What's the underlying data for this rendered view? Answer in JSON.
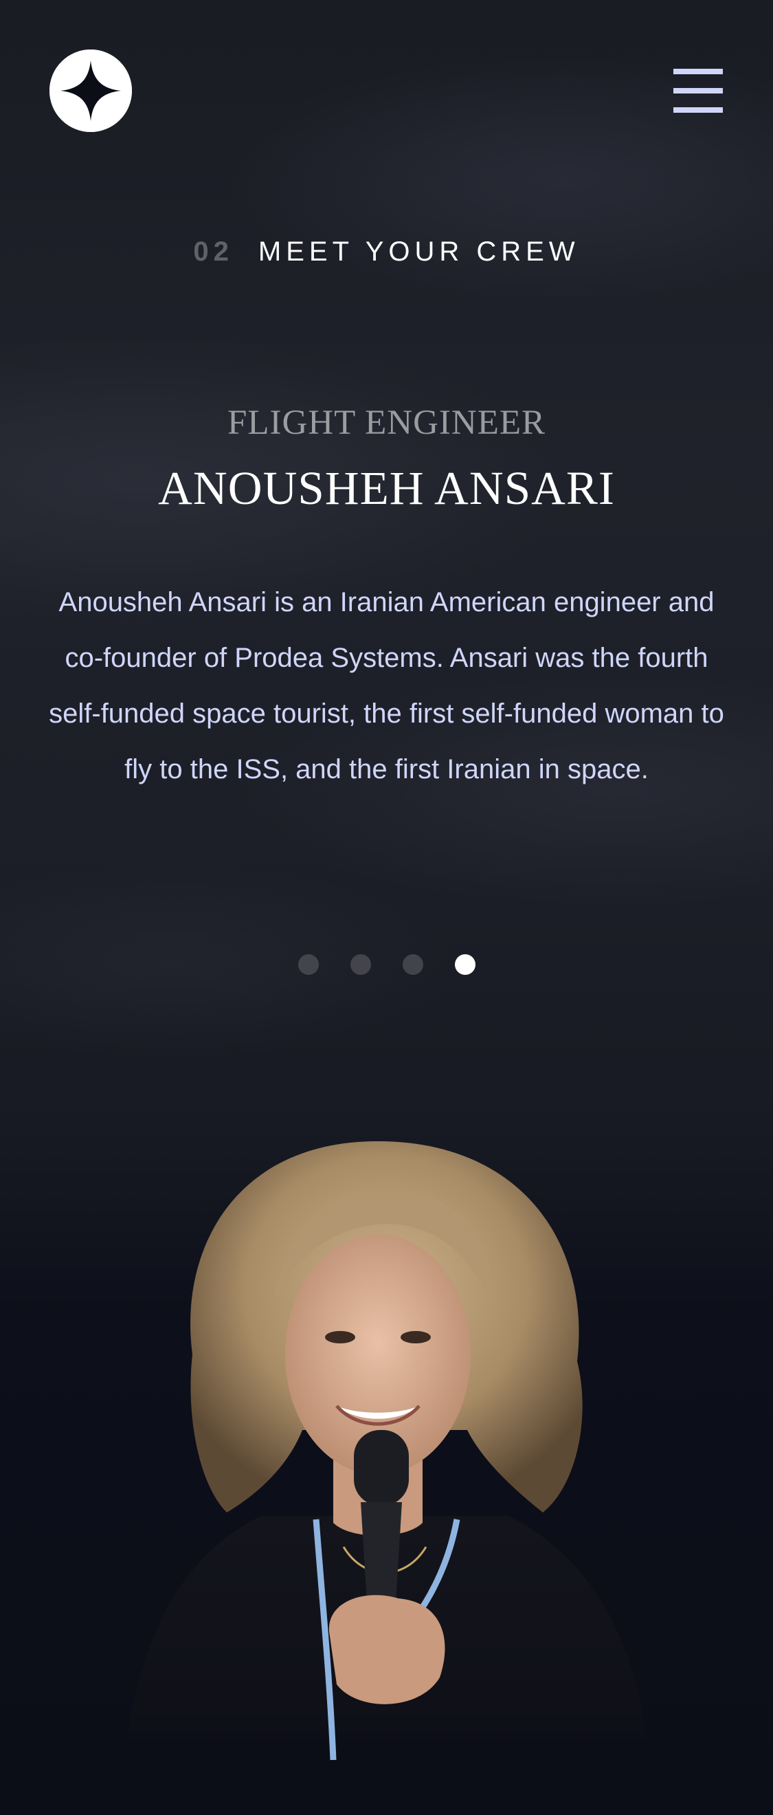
{
  "header": {
    "logo_icon": "star-logo-icon",
    "menu_icon": "hamburger-menu-icon"
  },
  "page": {
    "number": "02",
    "title": "MEET YOUR CREW"
  },
  "crew": {
    "role": "FLIGHT ENGINEER",
    "name": "ANOUSHEH ANSARI",
    "bio": "Anousheh Ansari is an Iranian American engineer and co-founder of Prodea Systems. Ansari was the fourth self-funded space tourist, the first self-funded woman to fly to the ISS, and the first Iranian in space."
  },
  "carousel": {
    "count": 4,
    "active_index": 3
  },
  "colors": {
    "background": "#0b0d17",
    "accent_light": "#d0d6f9",
    "white": "#ffffff"
  }
}
